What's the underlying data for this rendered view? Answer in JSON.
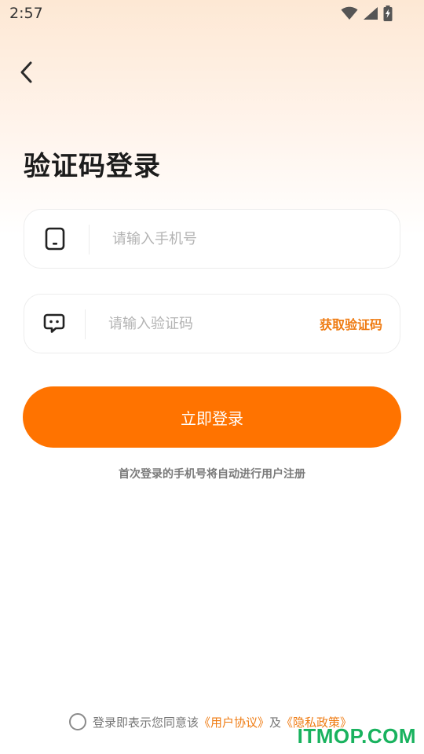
{
  "status_bar": {
    "time": "2:57",
    "icons": [
      "wifi-icon",
      "cell-signal-icon",
      "battery-charging-icon"
    ]
  },
  "header": {
    "back_icon": "chevron-left-icon",
    "title": "验证码登录"
  },
  "form": {
    "phone": {
      "icon": "phone-icon",
      "placeholder": "请输入手机号",
      "value": ""
    },
    "code": {
      "icon": "message-icon",
      "placeholder": "请输入验证码",
      "value": "",
      "get_code_label": "获取验证码"
    },
    "submit_label": "立即登录",
    "register_hint": "首次登录的手机号将自动进行用户注册"
  },
  "agreement": {
    "checked": false,
    "prefix": "登录即表示您同意该",
    "user_agreement": "《用户协议》",
    "conjunction": "及",
    "privacy_policy": "《隐私政策》"
  },
  "watermark": "ITMOP.COM",
  "colors": {
    "accent": "#ff7300",
    "link": "#ef7b12",
    "watermark": "#19b25e"
  }
}
